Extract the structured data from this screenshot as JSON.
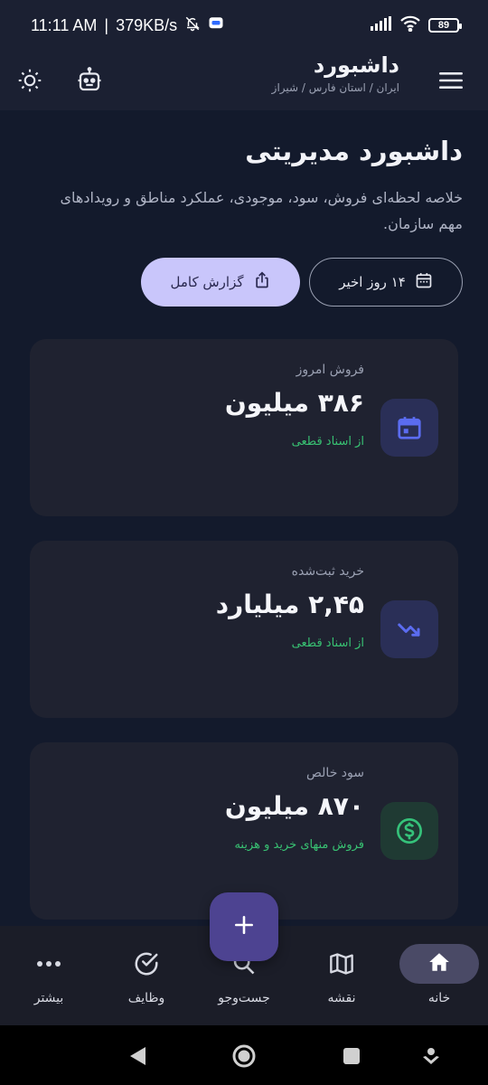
{
  "status_bar": {
    "time": "11:11 AM",
    "network_speed": "379KB/s",
    "battery": "89",
    "icons": [
      "mute-notification-icon",
      "message-icon",
      "signal-icon",
      "wifi-icon",
      "battery-icon"
    ]
  },
  "app_bar": {
    "title": "داشبورد",
    "breadcrumb": "ایران / استان فارس / شیراز",
    "icons": {
      "menu": "menu-icon",
      "robot": "robot-icon",
      "theme": "sun-icon"
    }
  },
  "page": {
    "title": "داشبورد مدیریتی",
    "description": "خلاصه لحظه‌ای فروش، سود، موجودی، عملکرد مناطق و رویدادهای مهم سازمان."
  },
  "actions": {
    "range_label": "۱۴ روز اخیر",
    "report_label": "گزارش کامل"
  },
  "cards": [
    {
      "label": "فروش امروز",
      "value": "۳۸۶ میلیون",
      "note": "از اسناد قطعی",
      "icon": "calendar-icon",
      "icon_bg": "#2a2f57",
      "icon_color": "#5b6cf0"
    },
    {
      "label": "خرید ثبت‌شده",
      "value": "۲,۴۵ میلیارد",
      "note": "از اسناد قطعی",
      "icon": "trend-down-icon",
      "icon_bg": "#2a2f57",
      "icon_color": "#5b6cf0"
    },
    {
      "label": "سود خالص",
      "value": "۸۷۰ میلیون",
      "note": "فروش منهای خرید و هزینه",
      "icon": "dollar-icon",
      "icon_bg": "#1f3a33",
      "icon_color": "#35c27a"
    }
  ],
  "bottom_nav": [
    {
      "label": "خانه",
      "icon": "home-icon",
      "active": true
    },
    {
      "label": "نقشه",
      "icon": "map-icon",
      "active": false
    },
    {
      "label": "جست‌وجو",
      "icon": "search-icon",
      "active": false
    },
    {
      "label": "وظایف",
      "icon": "task-check-icon",
      "active": false
    },
    {
      "label": "بیشتر",
      "icon": "more-icon",
      "active": false
    }
  ],
  "colors": {
    "accent": "#c9c6fb",
    "fab": "#4d4391",
    "positive": "#38c172",
    "background": "#131a2c"
  }
}
